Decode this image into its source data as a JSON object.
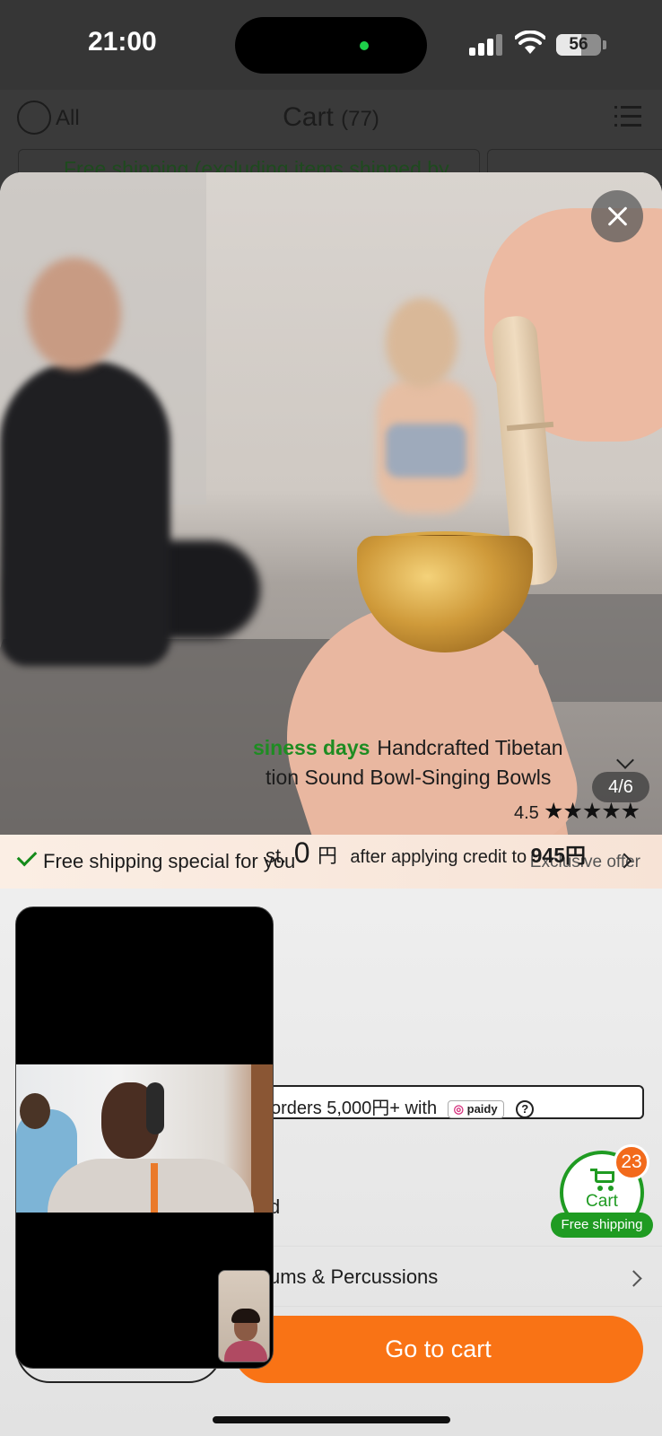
{
  "status_bar": {
    "time": "21:00",
    "battery": "56",
    "battery_level": 0.56
  },
  "cart_header": {
    "all_label": "All",
    "title": "Cart",
    "count": "(77)",
    "notice_text": "Free shipping (excluding items shipped by"
  },
  "modal": {
    "page_indicator": "4/6",
    "offer": {
      "text": "Free shipping special for you",
      "badge": "Exclusive offer"
    },
    "product": {
      "title_green": "siness days",
      "title_line1": "Handcrafted Tibetan",
      "title_line2": "tion Sound Bowl-Singing Bowls",
      "rating": "4.5",
      "stars": "★★★★★",
      "rating_value": 4.5
    },
    "price": {
      "prefix": "st.",
      "amount": "0",
      "currency": "円",
      "after_text": "after applying credit to",
      "credit_amount": "945円"
    },
    "paidy": {
      "text": "orders 5,000円+ with",
      "logo": "paidy",
      "help": "?"
    },
    "partial_label": "d",
    "category": "ums & Percussions",
    "go_cart_label": "Go to cart"
  },
  "floating_cart": {
    "label": "Cart",
    "badge": "23",
    "pill": "Free shipping"
  },
  "colors": {
    "accent_orange": "#f97315",
    "accent_green": "#1f9b22",
    "badge_orange": "#f26a1b"
  }
}
